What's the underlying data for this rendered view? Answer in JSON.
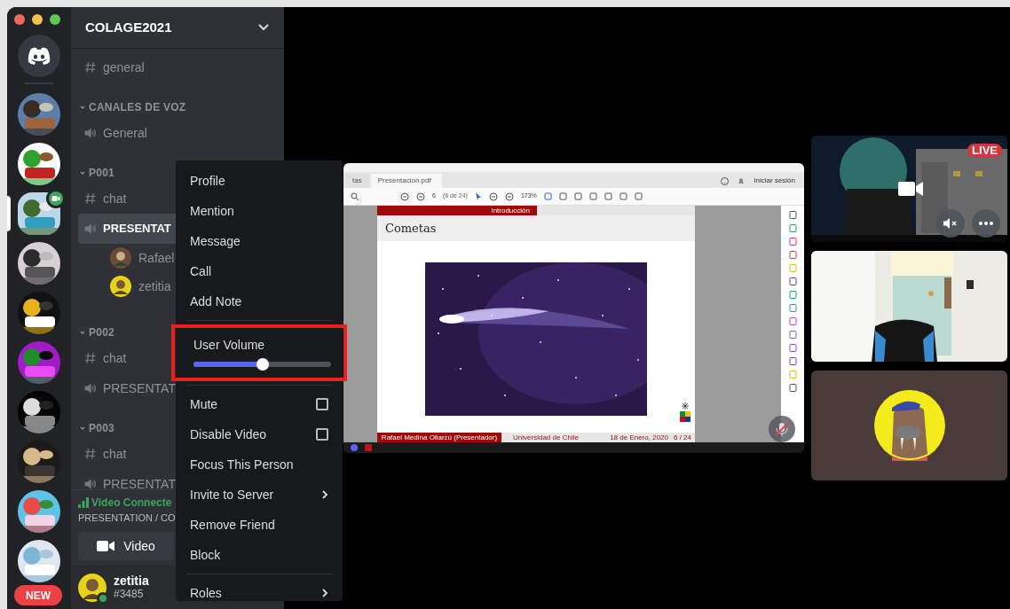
{
  "servers": [
    {
      "kind": "home",
      "selected": false
    },
    {
      "kind": "picture",
      "selected": false,
      "video": false
    },
    {
      "kind": "picture",
      "selected": false,
      "video": false
    },
    {
      "kind": "picture",
      "selected": true,
      "video": true
    },
    {
      "kind": "picture",
      "selected": false,
      "video": false
    },
    {
      "kind": "picture",
      "selected": false,
      "video": false
    },
    {
      "kind": "picture",
      "selected": false,
      "video": false
    },
    {
      "kind": "picture",
      "selected": false,
      "video": false
    },
    {
      "kind": "picture",
      "selected": false,
      "video": false
    },
    {
      "kind": "picture",
      "selected": false,
      "video": false
    },
    {
      "kind": "picture",
      "selected": false,
      "video": false
    }
  ],
  "new_badge": "NEW",
  "server_name": "COLAGE2021",
  "channels": [
    {
      "kind": "text",
      "name": "general",
      "selected": false
    },
    {
      "kind": "category",
      "name": "CANALES DE VOZ"
    },
    {
      "kind": "voice",
      "name": "General",
      "selected": false
    },
    {
      "kind": "category",
      "name": "P001"
    },
    {
      "kind": "text",
      "name": "chat",
      "selected": false
    },
    {
      "kind": "voice",
      "name": "PRESENTAT",
      "selected": true,
      "members": [
        {
          "name": "Rafael"
        },
        {
          "name": "zetitia"
        }
      ]
    },
    {
      "kind": "category",
      "name": "P002"
    },
    {
      "kind": "text",
      "name": "chat",
      "selected": false
    },
    {
      "kind": "voice",
      "name": "PRESENTAT",
      "selected": false
    },
    {
      "kind": "category",
      "name": "P003"
    },
    {
      "kind": "text",
      "name": "chat",
      "selected": false
    },
    {
      "kind": "voice",
      "name": "PRESENTAT",
      "selected": false
    }
  ],
  "voice_panel": {
    "status": "Video Connecte",
    "channel": "PRESENTATION / CO",
    "video_button": "Video"
  },
  "user": {
    "name": "zetitia",
    "tag": "#3485"
  },
  "screen_share": {
    "tabs": [
      {
        "label": "tas",
        "selected": false
      },
      {
        "label": "Presentacion.pdf",
        "selected": true
      }
    ],
    "sign_in": "Iniciar sesión",
    "page_number": "6",
    "page_count": "(6 de 24)",
    "zoom": "173%",
    "muted": true,
    "slide": {
      "section": "Introducción",
      "title": "Cometas",
      "footer_author": "Rafael Medina Ollarzú (Presentador)",
      "footer_institution": "Universidad de Chile",
      "footer_date": "18 de Enero, 2020",
      "footer_page": "6 / 24"
    }
  },
  "tiles": [
    {
      "kind": "stream",
      "badge": "LIVE"
    },
    {
      "kind": "camera"
    },
    {
      "kind": "avatar"
    }
  ],
  "context_menu": {
    "groups": [
      [
        {
          "kind": "item",
          "label": "Profile"
        },
        {
          "kind": "item",
          "label": "Mention"
        },
        {
          "kind": "item",
          "label": "Message"
        },
        {
          "kind": "item",
          "label": "Call"
        },
        {
          "kind": "item",
          "label": "Add Note"
        }
      ],
      [
        {
          "kind": "slider",
          "label": "User Volume",
          "level": 0.5,
          "highlighted": true
        }
      ],
      [
        {
          "kind": "checkbox",
          "label": "Mute",
          "checked": false
        },
        {
          "kind": "checkbox",
          "label": "Disable Video",
          "checked": false
        },
        {
          "kind": "item",
          "label": "Focus This Person"
        },
        {
          "kind": "submenu",
          "label": "Invite to Server"
        },
        {
          "kind": "item",
          "label": "Remove Friend"
        },
        {
          "kind": "item",
          "label": "Block"
        }
      ],
      [
        {
          "kind": "submenu",
          "label": "Roles"
        }
      ]
    ]
  }
}
